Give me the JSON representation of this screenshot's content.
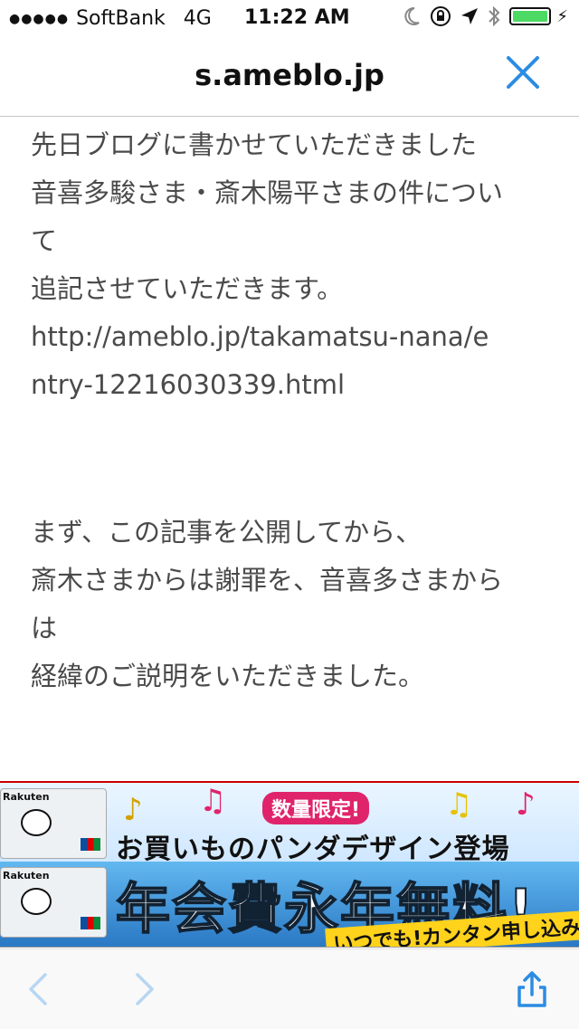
{
  "status_bar": {
    "carrier": "SoftBank",
    "network": "4G",
    "time": "11:22 AM"
  },
  "navbar": {
    "url": "s.ameblo.jp"
  },
  "article": {
    "paragraph1": [
      "先日ブログに書かせていただきました",
      "音喜多駿さま・斎木陽平さまの件につい",
      "て",
      "追記させていただきます。",
      "http://ameblo.jp/takamatsu-nana/e",
      "ntry-12216030339.html"
    ],
    "paragraph2": [
      "まず、この記事を公開してから、",
      "斎木さまからは謝罪を、音喜多さまから",
      "は",
      "経緯のご説明をいただきました。"
    ]
  },
  "ads": {
    "ad1": {
      "card_brand": "Rakuten",
      "badge": "数量限定!",
      "headline": "お買いものパンダデザイン登場"
    },
    "ad2": {
      "card_brand": "Rakuten",
      "headline": "年会費永年無料!",
      "sub": "いつでも!カンタン申し込み"
    }
  },
  "colors": {
    "accent": "#2b8ce3",
    "text": "#4a4a4a",
    "battery": "#4cd964"
  },
  "icons": {
    "close": "close-icon",
    "back": "back-chevron-icon",
    "forward": "forward-chevron-icon",
    "share": "share-icon"
  }
}
